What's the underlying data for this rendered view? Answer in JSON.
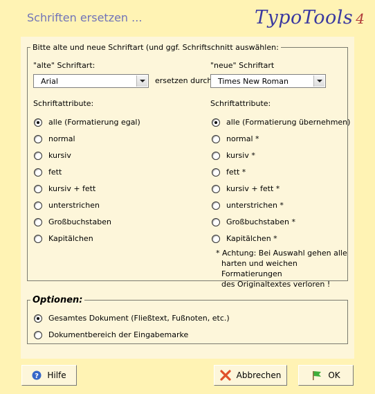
{
  "header": {
    "title": "Schriften ersetzen ...",
    "logo": "TypoTools",
    "logo_version": "4"
  },
  "group_fonts": {
    "legend": "Bitte alte und neue Schriftart (und ggf. Schriftschnitt auswählen:",
    "old_label": "\"alte\" Schriftart:",
    "old_value": "Arial",
    "replace_label": "ersetzen durch",
    "new_label": "\"neue\" Schriftart",
    "new_value": "Times New Roman",
    "attr_label_left": "Schriftattribute:",
    "attr_label_right": "Schriftattribute:",
    "left_options": [
      {
        "label": "alle (Formatierung egal)",
        "checked": true
      },
      {
        "label": "normal",
        "checked": false
      },
      {
        "label": "kursiv",
        "checked": false
      },
      {
        "label": "fett",
        "checked": false
      },
      {
        "label": "kursiv + fett",
        "checked": false
      },
      {
        "label": "unterstrichen",
        "checked": false
      },
      {
        "label": "Großbuchstaben",
        "checked": false
      },
      {
        "label": "Kapitälchen",
        "checked": false
      }
    ],
    "right_options": [
      {
        "label": "alle (Formatierung übernehmen)",
        "checked": true
      },
      {
        "label": "normal *",
        "checked": false
      },
      {
        "label": "kursiv *",
        "checked": false
      },
      {
        "label": "fett *",
        "checked": false
      },
      {
        "label": "kursiv + fett *",
        "checked": false
      },
      {
        "label": "unterstrichen *",
        "checked": false
      },
      {
        "label": "Großbuchstaben *",
        "checked": false
      },
      {
        "label": "Kapitälchen *",
        "checked": false
      }
    ],
    "note_lines": [
      "* Achtung: Bei Auswahl gehen alle",
      "harten und weichen Formatierungen",
      "des Originaltextes verloren !"
    ]
  },
  "group_options": {
    "legend": "Optionen:",
    "options": [
      {
        "label": "Gesamtes Dokument (Fließtext, Fußnoten, etc.)",
        "checked": true
      },
      {
        "label": "Dokumentbereich der Eingabemarke",
        "checked": false
      }
    ]
  },
  "buttons": {
    "help": "Hilfe",
    "cancel": "Abbrechen",
    "ok": "OK"
  }
}
